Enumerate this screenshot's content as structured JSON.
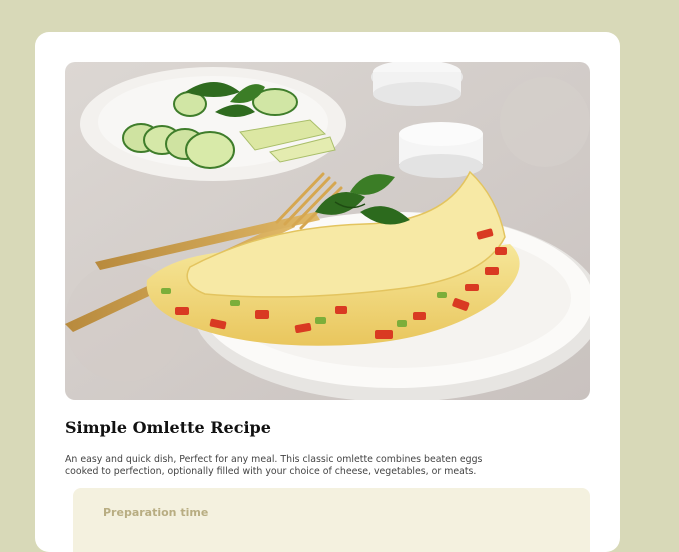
{
  "recipe": {
    "title": "Simple Omlette Recipe",
    "description": "An easy and quick dish, Perfect for any meal. This classic omlette combines beaten eggs cooked to perfection, optionally filled with your choice of cheese, vegetables, or meats.",
    "image_alt": "omelette-photo",
    "preparation": {
      "heading": "Preparation time"
    }
  },
  "colors": {
    "page_background": "#d8d9b8",
    "card_background": "#ffffff",
    "prep_background": "#f4f1df",
    "prep_heading": "#b8ad82"
  }
}
